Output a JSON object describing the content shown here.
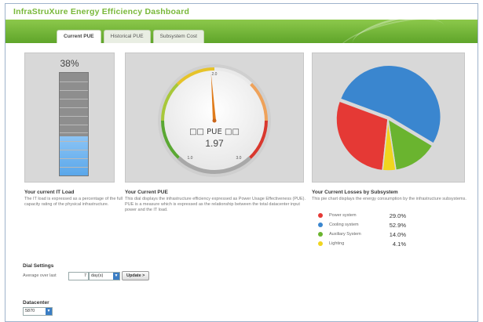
{
  "app": {
    "title": "InfraStruXure Energy Efficiency Dashboard"
  },
  "tabs": [
    {
      "label": "Current PUE",
      "active": true
    },
    {
      "label": "Historical PUE",
      "active": false
    },
    {
      "label": "Subsystem Cost",
      "active": false
    }
  ],
  "it_load": {
    "value_text": "38%",
    "fraction": 0.38,
    "title": "Your current IT Load",
    "description": "The IT load is expressed as a percentage of the full capacity rating of the physical infrastructure."
  },
  "pue": {
    "label": "□□ PUE □□",
    "value": "1.97",
    "value_num": 1.97,
    "scale_min": 1.0,
    "scale_max": 3.0,
    "scale_labels": [
      "1.0",
      "2.0",
      "3.0"
    ],
    "title": "Your Current PUE",
    "description": "This dial displays the infrastructure efficiency expressed as Power Usage Effectiveness (PUE). PUE is a measure which is expressed as the relationship between the total datacenter input power and the IT load."
  },
  "losses": {
    "title": "Your Current Losses by Subsystem",
    "description": "This pie chart displays the energy consumption by the infrastructure subsystems."
  },
  "chart_data": {
    "type": "pie",
    "categories": [
      "Power system",
      "Cooling system",
      "Auxiliary System",
      "Lighting"
    ],
    "values": [
      29.0,
      52.9,
      14.0,
      4.1
    ],
    "value_labels": [
      "29.0%",
      "52.9%",
      "14.0%",
      "4.1%"
    ],
    "colors": [
      "#e53935",
      "#3a86cf",
      "#6ab42f",
      "#f0d51f"
    ]
  },
  "dial_settings": {
    "title": "Dial Settings",
    "average_label": "Average over last",
    "average_value": "7",
    "unit_value": "day(s)",
    "update_label": "Update >"
  },
  "datacenter": {
    "title": "Datacenter",
    "selected": "5870"
  },
  "colors": {
    "brand_green": "#79b83a",
    "banner_green": "#6db136",
    "panel_bg": "#d8d8d8",
    "gauge_needle": "#e07b1a"
  }
}
